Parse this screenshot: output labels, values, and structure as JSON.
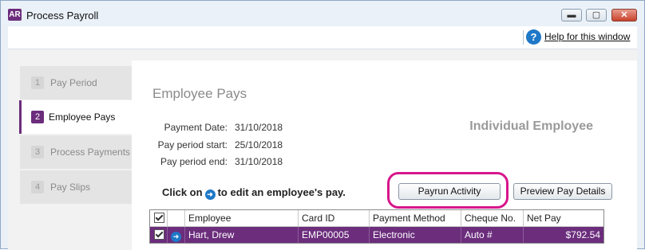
{
  "window": {
    "app_icon_text": "AR",
    "title": "Process Payroll",
    "controls": {
      "minimize": "▬",
      "restore": "▢",
      "close": "✕"
    }
  },
  "help": {
    "icon": "?",
    "link_text": "Help for this window"
  },
  "steps": [
    {
      "num": "1",
      "label": "Pay Period"
    },
    {
      "num": "2",
      "label": "Employee Pays"
    },
    {
      "num": "3",
      "label": "Process Payments"
    },
    {
      "num": "4",
      "label": "Pay Slips"
    }
  ],
  "panel": {
    "title": "Employee Pays",
    "mode": "Individual Employee",
    "payment_date_label": "Payment Date:",
    "payment_date": "31/10/2018",
    "period_start_label": "Pay period start:",
    "period_start": "25/10/2018",
    "period_end_label": "Pay period end:",
    "period_end": "31/10/2018",
    "instruction_pre": "Click on",
    "instruction_post": "to edit an employee's pay.",
    "payrun_button": "Payrun Activity",
    "preview_button": "Preview Pay Details"
  },
  "grid": {
    "headers": [
      "",
      "",
      "Employee",
      "Card ID",
      "Payment Method",
      "Cheque No.",
      "Net Pay"
    ],
    "rows": [
      {
        "employee": "Hart, Drew",
        "card_id": "EMP00005",
        "method": "Electronic",
        "cheque": "Auto #",
        "net_pay": "$792.54"
      }
    ]
  },
  "colors": {
    "accent": "#6b2d7c",
    "highlight": "#d7168c",
    "info": "#1f78c8"
  }
}
